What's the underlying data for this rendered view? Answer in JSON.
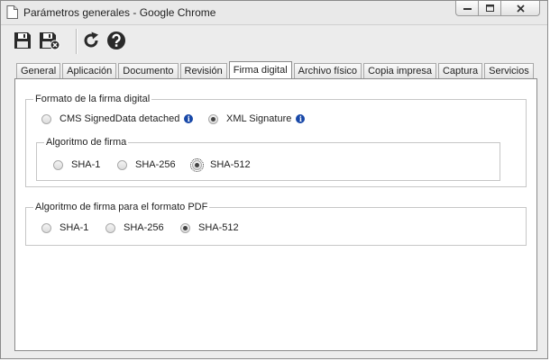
{
  "window": {
    "title": "Parámetros generales - Google Chrome"
  },
  "toolbar": {
    "save_icon": "save-icon",
    "save_close_icon": "save-close-icon",
    "refresh_icon": "refresh-icon",
    "help_icon": "help-icon"
  },
  "tabs": [
    {
      "label": "General"
    },
    {
      "label": "Aplicación"
    },
    {
      "label": "Documento"
    },
    {
      "label": "Revisión"
    },
    {
      "label": "Firma digital",
      "active": true
    },
    {
      "label": "Archivo físico"
    },
    {
      "label": "Copia impresa"
    },
    {
      "label": "Captura"
    },
    {
      "label": "Servicios"
    }
  ],
  "format_group": {
    "legend": "Formato de la firma digital",
    "options": [
      {
        "label": "CMS SignedData detached",
        "selected": false
      },
      {
        "label": "XML Signature",
        "selected": true
      }
    ],
    "algorithm_group": {
      "legend": "Algoritmo de firma",
      "options": [
        {
          "label": "SHA-1",
          "selected": false
        },
        {
          "label": "SHA-256",
          "selected": false
        },
        {
          "label": "SHA-512",
          "selected": true
        }
      ]
    }
  },
  "pdf_group": {
    "legend": "Algoritmo de firma para el formato PDF",
    "options": [
      {
        "label": "SHA-1",
        "selected": false
      },
      {
        "label": "SHA-256",
        "selected": false
      },
      {
        "label": "SHA-512",
        "selected": true
      }
    ]
  },
  "colors": {
    "info_icon": "#1848a8",
    "panel_border": "#8a8a8a"
  }
}
